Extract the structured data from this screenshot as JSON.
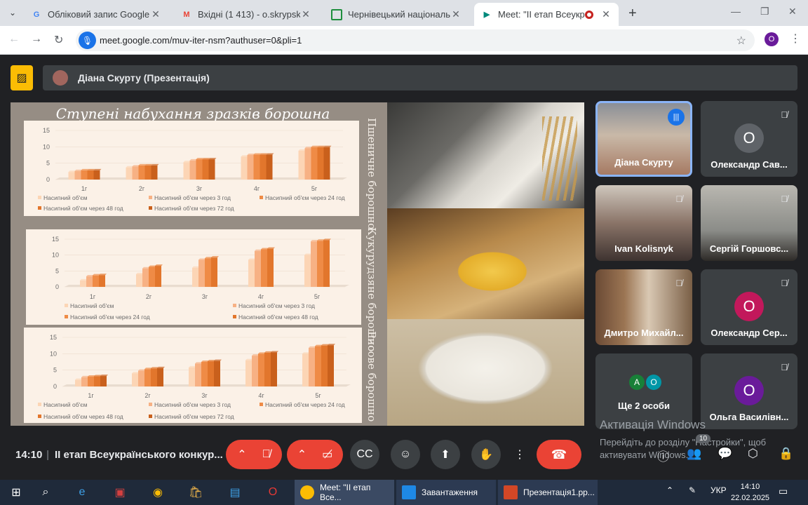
{
  "browser": {
    "tabs": [
      {
        "title": "Обліковий запис Google",
        "icon": "google-icon"
      },
      {
        "title": "Вхідні (1 413) - o.skrypska@chnu.edu.ua",
        "icon": "gmail-icon"
      },
      {
        "title": "Чернівецький національний університет",
        "icon": "classroom-icon"
      },
      {
        "title": "Meet: \"II етап Всеукраїнського\"",
        "icon": "meet-icon"
      }
    ],
    "url": "meet.google.com/muv-iter-nsm?authuser=0&pli=1",
    "profile_letter": "O"
  },
  "presentation": {
    "presenter": "Діана Скурту (Презентація)",
    "slide_title": "Ступені набухання зразків борошна",
    "vertical_labels": [
      "Пшеничне борошно",
      "Кукурудзяне борошно",
      "Рисове борошно"
    ]
  },
  "chart_data": [
    {
      "type": "bar",
      "categories": [
        "1г",
        "2г",
        "3г",
        "4г",
        "5г"
      ],
      "yticks": [
        "15",
        "10",
        "5",
        "0"
      ],
      "ylim": [
        0,
        15
      ],
      "series": [
        {
          "name": "Насипний об'єм",
          "values": [
            2.3,
            3.7,
            5.3,
            7.0,
            8.8
          ],
          "color": "#fcd5b5"
        },
        {
          "name": "Насипний об'єм через 3 год",
          "values": [
            2.6,
            4.0,
            5.8,
            7.5,
            9.6
          ],
          "color": "#f7b184"
        },
        {
          "name": "Насипний об'єм через 24 год",
          "values": [
            2.8,
            4.3,
            6.2,
            7.6,
            9.9
          ],
          "color": "#ef8b46"
        },
        {
          "name": "Насипний об'єм через 48 год",
          "values": [
            2.8,
            4.3,
            6.2,
            7.6,
            9.9
          ],
          "color": "#e2762c"
        },
        {
          "name": "Насипний об'єм через 72 год",
          "values": [
            2.8,
            4.3,
            6.2,
            7.6,
            9.9
          ],
          "color": "#c9601c"
        }
      ],
      "legend_position": "bottom"
    },
    {
      "type": "bar",
      "categories": [
        "1г",
        "2г",
        "3г",
        "4г",
        "5г"
      ],
      "yticks": [
        "15",
        "10",
        "5",
        "0"
      ],
      "ylim": [
        0,
        15
      ],
      "series": [
        {
          "name": "Насипний об'єм",
          "values": [
            2.0,
            4.0,
            6.0,
            8.5,
            10.0
          ],
          "color": "#fcd5b5"
        },
        {
          "name": "Насипний об'єм через 3 год",
          "values": [
            3.3,
            5.8,
            8.5,
            11.3,
            14.3
          ],
          "color": "#f7b184"
        },
        {
          "name": "Насипний об'єм через 24 год",
          "values": [
            3.6,
            6.3,
            9.0,
            11.8,
            14.5
          ],
          "color": "#ef8b46"
        },
        {
          "name": "Насипний об'єм через 48 год",
          "values": [
            3.7,
            6.6,
            9.2,
            12.0,
            14.7
          ],
          "color": "#e2762c"
        }
      ],
      "legend_position": "bottom"
    },
    {
      "type": "bar",
      "categories": [
        "1г",
        "2г",
        "3г",
        "4г",
        "5г"
      ],
      "yticks": [
        "15",
        "10",
        "5",
        "0"
      ],
      "ylim": [
        0,
        15
      ],
      "series": [
        {
          "name": "Насипний об'єм",
          "values": [
            2.0,
            4.0,
            5.8,
            8.0,
            10.0
          ],
          "color": "#fcd5b5"
        },
        {
          "name": "Насипний об'єм через 3 год",
          "values": [
            2.8,
            4.8,
            7.0,
            9.4,
            11.8
          ],
          "color": "#f7b184"
        },
        {
          "name": "Насипний об'єм через 24 год",
          "values": [
            3.0,
            5.3,
            7.5,
            10.0,
            12.3
          ],
          "color": "#ef8b46"
        },
        {
          "name": "Насипний об'єм через 48 год",
          "values": [
            3.1,
            5.5,
            7.7,
            10.3,
            12.5
          ],
          "color": "#e2762c"
        },
        {
          "name": "Насипний об'єм через 72 год",
          "values": [
            3.2,
            5.6,
            7.8,
            10.4,
            12.6
          ],
          "color": "#c9601c"
        }
      ],
      "legend_position": "bottom"
    }
  ],
  "participants": [
    {
      "name": "Діана Скурту",
      "speaking": true
    },
    {
      "name": "Олександр Сав...",
      "initial": "О",
      "color": "#5f6368"
    },
    {
      "name": "Ivan Kolisnyk"
    },
    {
      "name": "Сергій Горшовс..."
    },
    {
      "name": "Дмитро Михайл..."
    },
    {
      "name": "Олександр Сер...",
      "initial": "О",
      "color": "#c2185b"
    },
    {
      "name": "Ще 2 особи",
      "initials": [
        "А",
        "О"
      ]
    },
    {
      "name": "Ольга Василівн...",
      "initial": "О",
      "color": "#6a1b9a"
    }
  ],
  "activation": {
    "title": "Активація Windows",
    "line1": "Перейдіть до розділу \"Настройки\", щоб",
    "line2": "активувати Windows."
  },
  "meeting": {
    "time": "14:10",
    "title": "II етап Всеукраїнського конкур...",
    "participant_count": "10"
  },
  "taskbar": {
    "apps": [
      "Meet: \"II етап Все...",
      "Завантаження",
      "Презентація1.pp..."
    ],
    "lang": "УКР",
    "time": "14:10",
    "date": "22.02.2025"
  }
}
